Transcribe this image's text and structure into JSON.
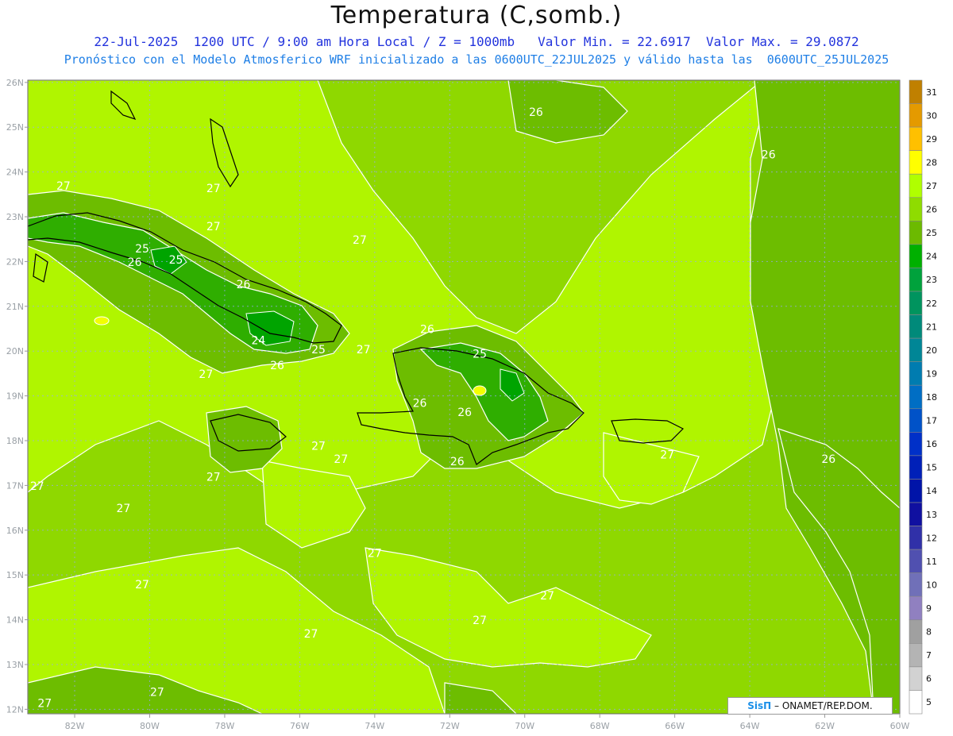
{
  "title": "Temperatura (C,somb.)",
  "subtitle_line1": "22-Jul-2025  1200 UTC / 9:00 am Hora Local / Z = 1000mb   Valor Min. = 22.6917  Valor Max. = 29.0872",
  "subtitle_line2": "Pronóstico con el Modelo Atmosferico WRF inicializado a las 0600UTC_22JUL2025 y válido hasta las  0600UTC_25JUL2025",
  "credit_brand": "SisΠ",
  "credit_text": " – ONAMET/REP.DOM.",
  "lat_labels": [
    "26N",
    "25N",
    "24N",
    "23N",
    "22N",
    "21N",
    "20N",
    "19N",
    "18N",
    "17N",
    "16N",
    "15N",
    "14N",
    "13N",
    "12N"
  ],
  "lon_labels": [
    "82W",
    "80W",
    "78W",
    "76W",
    "74W",
    "72W",
    "70W",
    "68W",
    "66W",
    "64W",
    "62W",
    "60W"
  ],
  "colorbar": {
    "levels": [
      31,
      30,
      29,
      28,
      27,
      26,
      25,
      24,
      23,
      22,
      21,
      20,
      19,
      18,
      17,
      16,
      15,
      14,
      13,
      12,
      11,
      10,
      9,
      8,
      7,
      6,
      5
    ],
    "colors": [
      "#c08000",
      "#e49a00",
      "#ffc000",
      "#ffff00",
      "#b0ff00",
      "#8fdc00",
      "#6cba00",
      "#00b000",
      "#00a23c",
      "#00945e",
      "#008a7a",
      "#008696",
      "#007cb0",
      "#006ec4",
      "#0052c8",
      "#0030c8",
      "#0020b8",
      "#0014a8",
      "#1010a0",
      "#3030a8",
      "#5050b0",
      "#7070b8",
      "#9080c0",
      "#a0a0a0",
      "#b4b4b4",
      "#d2d2d2",
      "#ffffff"
    ]
  },
  "contour_labels": [
    {
      "text": "27",
      "lon": -82.3,
      "lat": 23.6
    },
    {
      "text": "27",
      "lon": -78.3,
      "lat": 23.55
    },
    {
      "text": "27",
      "lon": -78.3,
      "lat": 22.7
    },
    {
      "text": "25",
      "lon": -80.2,
      "lat": 22.2
    },
    {
      "text": "26",
      "lon": -80.4,
      "lat": 21.9
    },
    {
      "text": "25",
      "lon": -79.3,
      "lat": 21.95
    },
    {
      "text": "26",
      "lon": -77.5,
      "lat": 21.4
    },
    {
      "text": "24",
      "lon": -77.1,
      "lat": 20.15
    },
    {
      "text": "25",
      "lon": -75.5,
      "lat": 19.95
    },
    {
      "text": "26",
      "lon": -76.6,
      "lat": 19.6
    },
    {
      "text": "27",
      "lon": -74.3,
      "lat": 19.95
    },
    {
      "text": "27",
      "lon": -78.5,
      "lat": 19.4
    },
    {
      "text": "27",
      "lon": -74.4,
      "lat": 22.4
    },
    {
      "text": "26",
      "lon": -72.6,
      "lat": 20.4
    },
    {
      "text": "25",
      "lon": -71.2,
      "lat": 19.85
    },
    {
      "text": "26",
      "lon": -72.8,
      "lat": 18.75
    },
    {
      "text": "26",
      "lon": -71.6,
      "lat": 18.55
    },
    {
      "text": "26",
      "lon": -71.8,
      "lat": 17.45
    },
    {
      "text": "27",
      "lon": -75.5,
      "lat": 17.8
    },
    {
      "text": "27",
      "lon": -74.9,
      "lat": 17.5
    },
    {
      "text": "27",
      "lon": -78.3,
      "lat": 17.1
    },
    {
      "text": "27",
      "lon": -83.0,
      "lat": 16.9
    },
    {
      "text": "27",
      "lon": -80.7,
      "lat": 16.4
    },
    {
      "text": "27",
      "lon": -74.0,
      "lat": 15.4
    },
    {
      "text": "27",
      "lon": -80.2,
      "lat": 14.7
    },
    {
      "text": "27",
      "lon": -69.4,
      "lat": 14.45
    },
    {
      "text": "27",
      "lon": -71.2,
      "lat": 13.9
    },
    {
      "text": "27",
      "lon": -75.7,
      "lat": 13.6
    },
    {
      "text": "27",
      "lon": -79.8,
      "lat": 12.3
    },
    {
      "text": "27",
      "lon": -82.8,
      "lat": 12.05
    },
    {
      "text": "26",
      "lon": -69.7,
      "lat": 25.25
    },
    {
      "text": "26",
      "lon": -63.5,
      "lat": 24.3
    },
    {
      "text": "27",
      "lon": -66.2,
      "lat": 17.6
    },
    {
      "text": "26",
      "lon": -61.9,
      "lat": 17.5
    }
  ]
}
